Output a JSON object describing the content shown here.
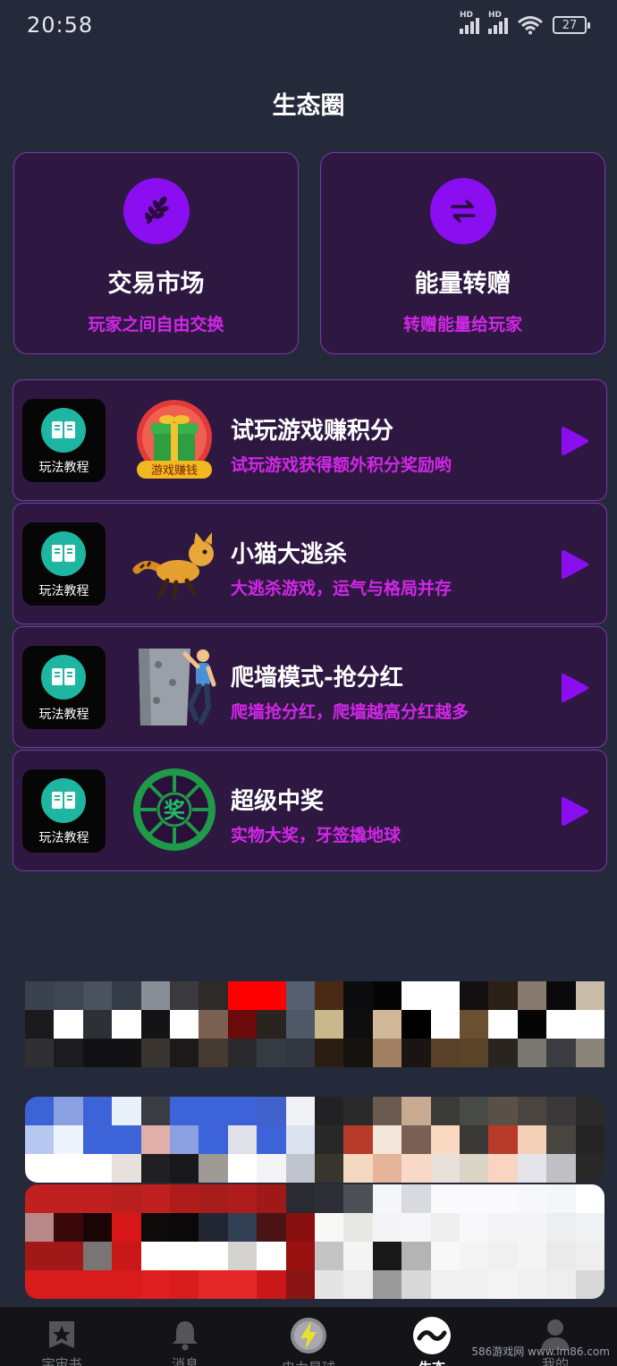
{
  "status": {
    "time": "20:58",
    "battery": "27"
  },
  "page_title": "生态圈",
  "features": [
    {
      "title": "交易市场",
      "subtitle": "玩家之间自由交换",
      "icon": "leaf-icon"
    },
    {
      "title": "能量转赠",
      "subtitle": "转赠能量给玩家",
      "icon": "exchange-arrows-icon"
    }
  ],
  "tutorial_label": "玩法教程",
  "games": [
    {
      "title": "试玩游戏赚积分",
      "subtitle": "试玩游戏获得额外积分奖励哟",
      "badge": "游戏赚钱"
    },
    {
      "title": "小猫大逃杀",
      "subtitle": "大逃杀游戏，运气与格局并存"
    },
    {
      "title": "爬墙模式-抢分红",
      "subtitle": "爬墙抢分红，爬墙越高分红越多"
    },
    {
      "title": "超级中奖",
      "subtitle": "实物大奖，牙签撬地球",
      "badge": "奖"
    }
  ],
  "tabs": [
    {
      "label": "宇宙书",
      "icon": "book-star-icon",
      "active": false
    },
    {
      "label": "消息",
      "icon": "bell-icon",
      "active": false
    },
    {
      "label": "电力星球",
      "icon": "lightning-planet-icon",
      "active": false
    },
    {
      "label": "生态",
      "icon": "ecology-icon",
      "active": true
    },
    {
      "label": "我的",
      "icon": "profile-icon",
      "active": false
    }
  ],
  "watermark": "586游戏网 www.lm86.com",
  "colors": {
    "background": "#252a3b",
    "card": "#2e1842",
    "accent": "#8a0ef0",
    "subtitle": "#d327e8"
  }
}
